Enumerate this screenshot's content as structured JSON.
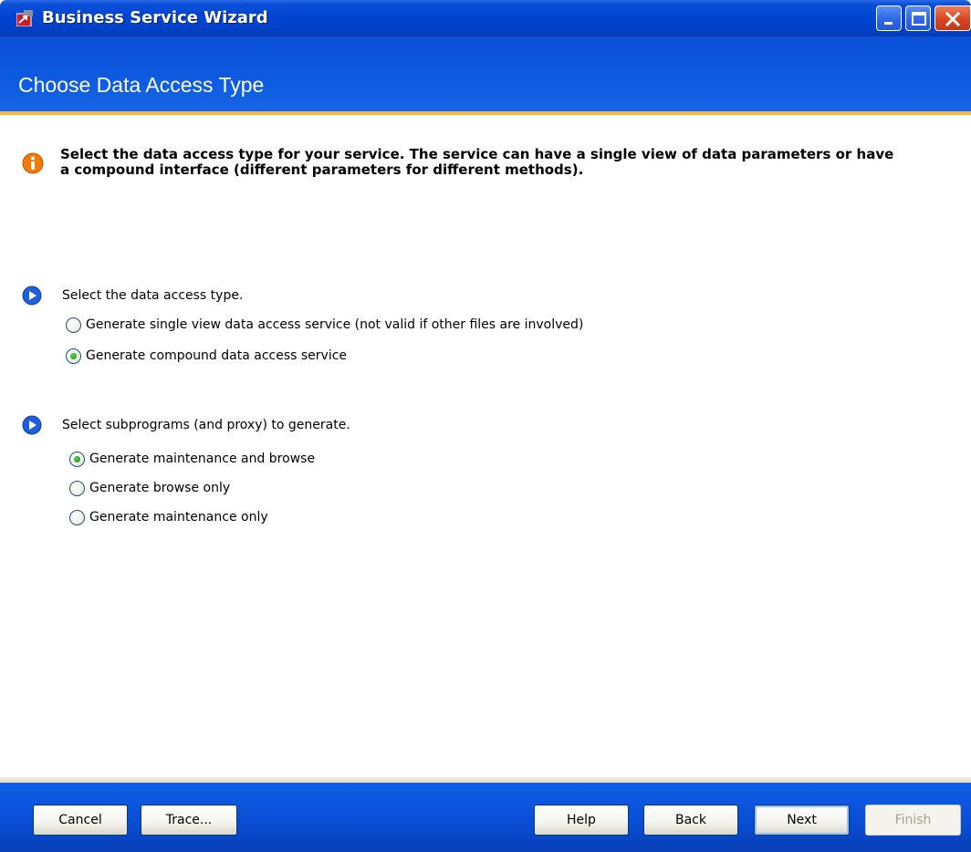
{
  "window": {
    "title": "Business Service Wizard"
  },
  "header": {
    "title": "Choose Data Access Type"
  },
  "info": {
    "text": "Select the data access type for your service. The service can have a single view of data parameters or have a compound interface (different parameters for different methods)."
  },
  "access_section": {
    "label": "Select the data access type.",
    "options": [
      {
        "label": "Generate single view data access service (not valid if other files are involved)",
        "checked": false
      },
      {
        "label": "Generate compound data access service",
        "checked": true
      }
    ]
  },
  "subprogram_section": {
    "label": "Select subprograms (and proxy) to generate.",
    "options": [
      {
        "label": "Generate maintenance and browse",
        "checked": true
      },
      {
        "label": "Generate browse only",
        "checked": false
      },
      {
        "label": "Generate maintenance only",
        "checked": false
      }
    ]
  },
  "buttons": {
    "cancel": "Cancel",
    "trace": "Trace...",
    "help": "Help",
    "back": "Back",
    "next": "Next",
    "finish": "Finish"
  },
  "colors": {
    "title_bar": "#0044d0",
    "header_rule": "#f0b74a",
    "info_icon": "#f07a0a",
    "step_arrow": "#1e5fd8",
    "radio_checked": "#21a121"
  },
  "icons": {
    "app": "wizard-app-icon",
    "info": "info-icon",
    "step": "arrow-right-circle-icon"
  }
}
